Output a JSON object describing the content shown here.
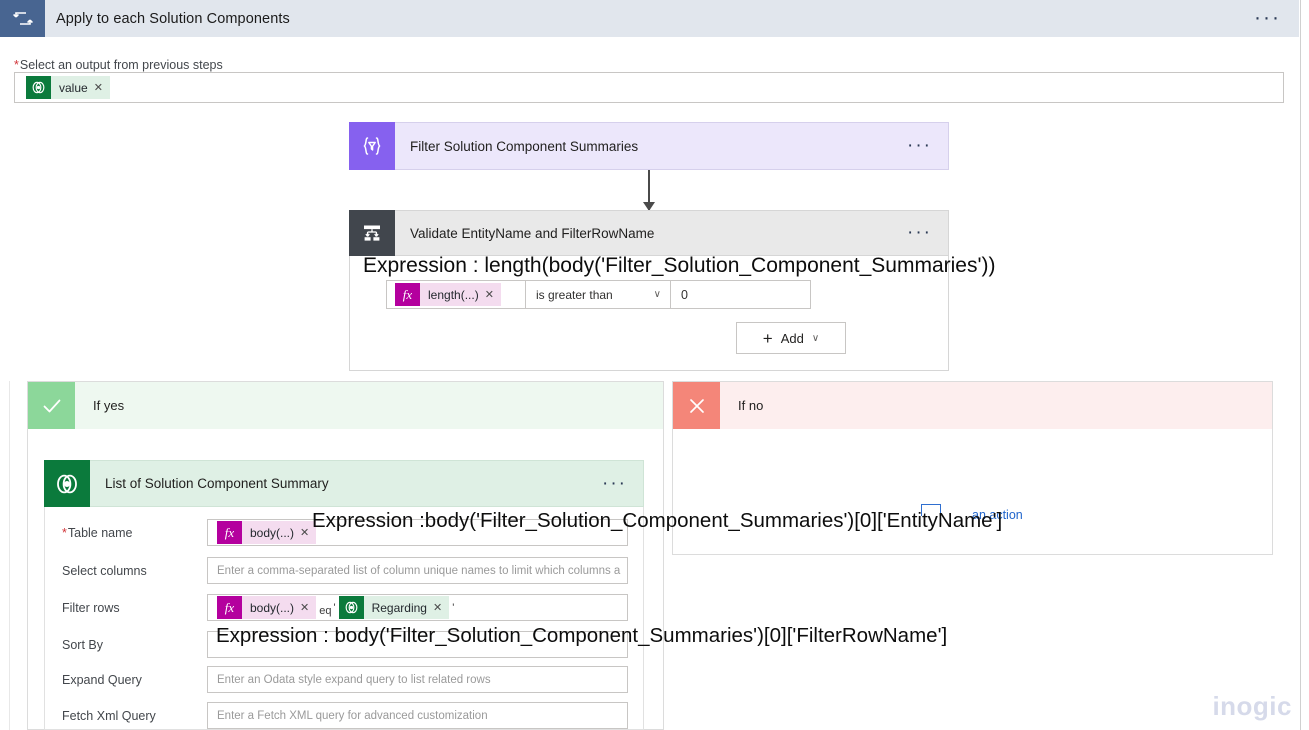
{
  "titlebar": {
    "title": "Apply to each Solution Components",
    "icon": "loop-icon",
    "menu": "···"
  },
  "foreach": {
    "label": "Select an output from previous steps",
    "required_marker": "*",
    "token": {
      "text": "value",
      "remove": "✕",
      "icon": "dataverse-icon"
    }
  },
  "filter_action": {
    "title": "Filter Solution Component Summaries",
    "icon": "{∇}",
    "icon_name": "filter-array-icon",
    "menu": "···",
    "accent": "#8661ef"
  },
  "condition_action": {
    "title": "Validate EntityName and FilterRowName",
    "icon_name": "condition-icon",
    "menu": "···",
    "accent": "#41464d",
    "left_token": {
      "text": "length(...)",
      "remove": "✕",
      "icon": "fx-icon",
      "glyph": "fx"
    },
    "operator": {
      "value": "is greater than",
      "chevron": "∨"
    },
    "right_value": "0",
    "add_button": {
      "label": "Add",
      "plus": "+",
      "chevron": "∨"
    }
  },
  "annotations": {
    "condition_expression": "Expression : length(body('Filter_Solution_Component_Summaries'))",
    "table_name_expression": "Expression :body('Filter_Solution_Component_Summaries')[0]['EntityName']",
    "sort_by_expression": "Expression : body('Filter_Solution_Component_Summaries')[0]['FilterRowName']"
  },
  "yes_branch": {
    "label": "If yes",
    "badge_icon": "checkmark-icon",
    "badge_color": "#8cd79a"
  },
  "no_branch": {
    "label": "If no",
    "badge_icon": "close-x-icon",
    "badge_color": "#f48679",
    "add_action_link": "an action"
  },
  "dataverse_action": {
    "title": "List of Solution Component Summary",
    "icon_name": "dataverse-icon",
    "menu": "···",
    "accent": "#0b7a3c"
  },
  "form": {
    "rows": [
      {
        "label": "Table name",
        "required": true,
        "type": "token",
        "token": {
          "text": "body(...)",
          "remove": "✕",
          "glyph": "fx"
        }
      },
      {
        "label": "Select columns",
        "required": false,
        "type": "placeholder",
        "placeholder": "Enter a comma-separated list of column unique names to limit which columns a"
      },
      {
        "label": "Filter rows",
        "required": false,
        "type": "filter",
        "token": {
          "text": "body(...)",
          "remove": "✕",
          "glyph": "fx"
        },
        "operator_text": "eq",
        "quote_open": "'",
        "token2": {
          "text": "Regarding",
          "remove": "✕",
          "icon": "dataverse-icon"
        },
        "quote_close": "'"
      },
      {
        "label": "Sort By",
        "required": false,
        "type": "placeholder",
        "placeholder": ""
      },
      {
        "label": "Expand Query",
        "required": false,
        "type": "placeholder",
        "placeholder": "Enter an Odata style expand query to list related rows"
      },
      {
        "label": "Fetch Xml Query",
        "required": false,
        "type": "placeholder",
        "placeholder": "Enter a Fetch XML query for advanced customization"
      }
    ]
  },
  "watermark": {
    "text": "inogic"
  }
}
